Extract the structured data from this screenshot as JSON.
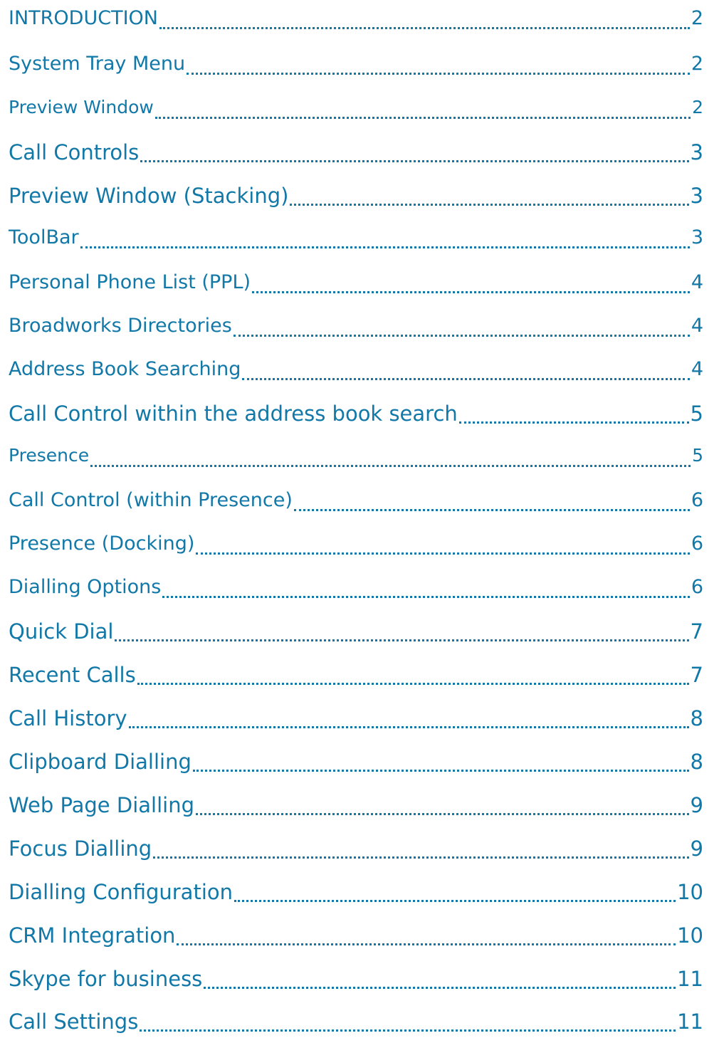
{
  "toc": [
    {
      "title": "INTRODUCTION",
      "page": "2"
    },
    {
      "title": "System Tray Menu",
      "page": "2"
    },
    {
      "title": "Preview Window",
      "page": "2"
    },
    {
      "title": "Call Controls",
      "page": "3"
    },
    {
      "title": "Preview Window (Stacking)",
      "page": "3"
    },
    {
      "title": "ToolBar",
      "page": "3"
    },
    {
      "title": "Personal Phone List (PPL)",
      "page": "4"
    },
    {
      "title": "Broadworks Directories",
      "page": "4"
    },
    {
      "title": "Address Book Searching",
      "page": "4"
    },
    {
      "title": "Call Control within the address book search",
      "page": "5"
    },
    {
      "title": "Presence",
      "page": "5"
    },
    {
      "title": "Call Control (within Presence)",
      "page": "6"
    },
    {
      "title": "Presence (Docking)",
      "page": "6"
    },
    {
      "title": "Dialling Options",
      "page": "6"
    },
    {
      "title": "Quick Dial",
      "page": "7"
    },
    {
      "title": "Recent Calls",
      "page": "7"
    },
    {
      "title": "Call History",
      "page": "8"
    },
    {
      "title": "Clipboard Dialling",
      "page": "8"
    },
    {
      "title": "Web Page Dialling",
      "page": "9"
    },
    {
      "title": "Focus Dialling",
      "page": "9"
    },
    {
      "title": "Dialling Configuration",
      "page": "10"
    },
    {
      "title": "CRM Integration",
      "page": "10"
    },
    {
      "title": "Skype for business",
      "page": "11"
    },
    {
      "title": "Call Settings",
      "page": "11"
    }
  ]
}
